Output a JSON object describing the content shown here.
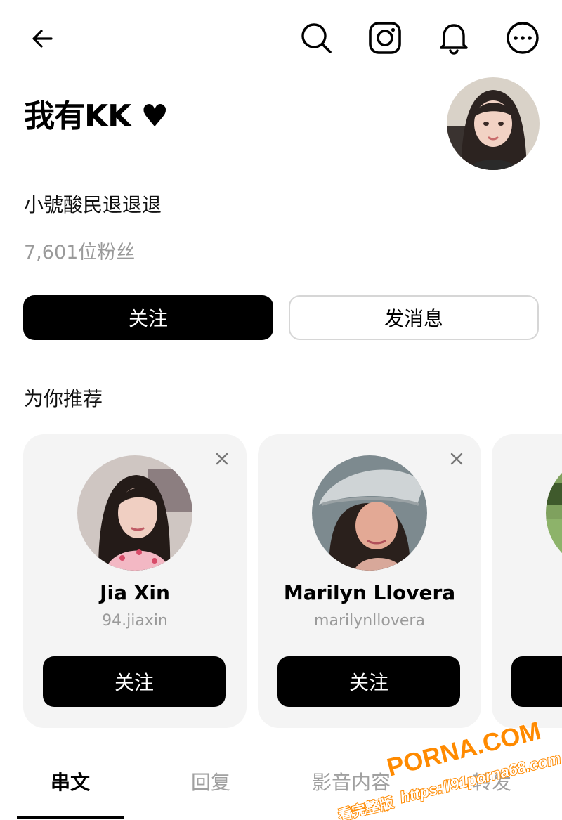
{
  "topbar": {
    "icons": [
      "back-arrow-icon",
      "search-icon",
      "instagram-icon",
      "bell-icon",
      "more-icon"
    ]
  },
  "profile": {
    "name": "我有KK ♥",
    "bio": "小號酸民退退退",
    "followers": "7,601位粉丝",
    "follow_label": "关注",
    "message_label": "发消息"
  },
  "suggestions": {
    "title": "为你推荐",
    "cards": [
      {
        "name": "Jia Xin",
        "handle": "94.jiaxin",
        "follow_label": "关注"
      },
      {
        "name": "Marilyn Llovera",
        "handle": "marilynllovera",
        "follow_label": "关注"
      }
    ]
  },
  "tabs": [
    "串文",
    "回复",
    "影音内容",
    "转发"
  ],
  "watermark": {
    "brand": "PORNA.COM",
    "url": "https://91porna68.com",
    "tagline": "看完整版"
  },
  "colors": {
    "primary": "#000000",
    "muted_text": "#9a9a9a",
    "card_bg": "#f4f4f4",
    "watermark_orange": "#ff8a00"
  }
}
